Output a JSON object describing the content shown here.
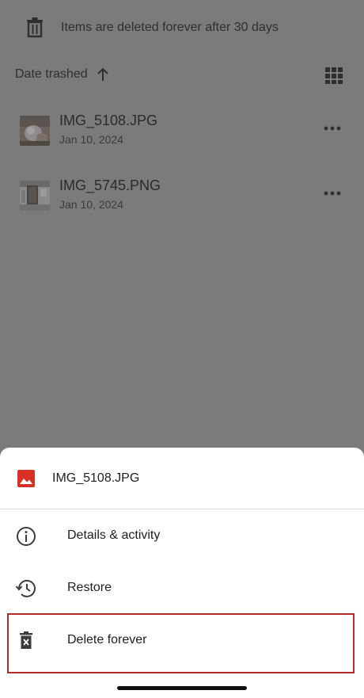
{
  "banner": {
    "text": "Items are deleted forever after 30 days",
    "icon": "trash-icon"
  },
  "sort": {
    "label": "Date trashed",
    "direction_icon": "arrow-up-icon",
    "view_toggle_icon": "grid-view-icon"
  },
  "files": [
    {
      "name": "IMG_5108.JPG",
      "date": "Jan 10, 2024"
    },
    {
      "name": "IMG_5745.PNG",
      "date": "Jan 10, 2024"
    }
  ],
  "sheet": {
    "title": "IMG_5108.JPG",
    "title_icon": "image-icon",
    "actions": [
      {
        "label": "Details & activity",
        "icon": "info-icon"
      },
      {
        "label": "Restore",
        "icon": "restore-icon"
      },
      {
        "label": "Delete forever",
        "icon": "delete-forever-icon"
      }
    ]
  },
  "colors": {
    "scrim": "#7b7b7b",
    "sheet_bg": "#ffffff",
    "highlight_border": "#b22a2a",
    "image_icon": "#d93025"
  }
}
